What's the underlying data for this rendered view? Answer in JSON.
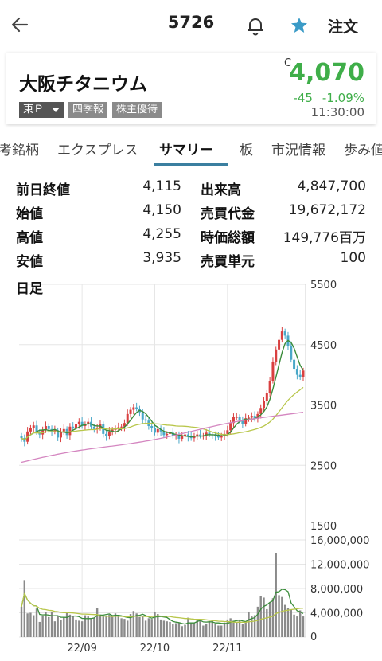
{
  "header": {
    "code": "5726",
    "order_label": "注文",
    "accent": "#3b9bc7"
  },
  "quote": {
    "name": "大阪チタニウム",
    "market": "東Ｐ",
    "tags": [
      "四季報",
      "株主優待"
    ],
    "close_mark": "C",
    "price": "4,070",
    "change": "-45",
    "change_pct": "-1.09%",
    "time": "11:30:00",
    "down_color": "#3fae49"
  },
  "tabs": [
    "考銘柄",
    "エクスプレス",
    "サマリー",
    "板",
    "市況情報",
    "歩み値"
  ],
  "active_tab": 2,
  "stats": [
    {
      "l1": "前日終値",
      "v1": "4,115",
      "l2": "出来高",
      "v2": "4,847,700"
    },
    {
      "l1": "始値",
      "v1": "4,150",
      "l2": "売買代金",
      "v2": "19,672,172"
    },
    {
      "l1": "高値",
      "v1": "4,255",
      "l2": "時価総額",
      "v2": "149,776百万"
    },
    {
      "l1": "安値",
      "v1": "3,935",
      "l2": "売買単元",
      "v2": "100"
    }
  ],
  "chart_data": {
    "type": "candlestick",
    "period_label": "日足",
    "price_ticks": [
      "5500",
      "4500",
      "3500",
      "2500",
      "1500"
    ],
    "volume_ticks": [
      "16,000,000",
      "12,000,000",
      "8,000,000",
      "4,000,000",
      "0"
    ],
    "date_labels": [
      "22/09",
      "22/10",
      "22/11"
    ],
    "price_ylim": [
      1500,
      5500
    ],
    "volume_ylim": [
      0,
      16000000
    ],
    "up_color": "#d94040",
    "down_color": "#4aa8c8",
    "ma_short_color": "#3a8c3a",
    "ma_mid_color": "#b8c64a",
    "ma_long_color": "#d486c0",
    "closes": [
      2950,
      2890,
      3060,
      3120,
      3160,
      3050,
      3010,
      3080,
      3150,
      3100,
      3060,
      3080,
      2960,
      3050,
      3100,
      3000,
      3140,
      3120,
      3180,
      3220,
      3150,
      3180,
      3220,
      3140,
      3100,
      3120,
      3180,
      3020,
      2980,
      3060,
      3090,
      3100,
      3130,
      3140,
      3200,
      3350,
      3420,
      3460,
      3440,
      3380,
      3260,
      3240,
      3150,
      3120,
      3040,
      3100,
      3060,
      3000,
      3020,
      3040,
      2990,
      3000,
      2940,
      2980,
      3010,
      2970,
      2950,
      2990,
      3010,
      2990,
      2990,
      3040,
      3010,
      3000,
      2980,
      2960,
      2990,
      3020,
      3080,
      3200,
      3300,
      3300,
      3250,
      3190,
      3280,
      3290,
      3320,
      3270,
      3350,
      3450,
      3560,
      3700,
      3900,
      4220,
      4420,
      4580,
      4720,
      4650,
      4480,
      4250,
      4100,
      4000,
      3960,
      4070
    ],
    "volumes": [
      5000000,
      9400000,
      3900000,
      4000000,
      3600000,
      4700000,
      2500000,
      3500000,
      4100000,
      3300000,
      4100000,
      2600000,
      3500000,
      2800000,
      3300000,
      4000000,
      3700000,
      3500000,
      2900000,
      2700000,
      2600000,
      3600000,
      3400000,
      3000000,
      3200000,
      4800000,
      3700000,
      3400000,
      3500000,
      3700000,
      3400000,
      3900000,
      3400000,
      3100000,
      3000000,
      2700000,
      3800000,
      4300000,
      3900000,
      3300000,
      3500000,
      2700000,
      3100000,
      3000000,
      4200000,
      3800000,
      2900000,
      2700000,
      2600000,
      2500000,
      2200000,
      2300000,
      2400000,
      1800000,
      2000000,
      3200000,
      2300000,
      2400000,
      2900000,
      3000000,
      1900000,
      2200000,
      2600000,
      2800000,
      2200000,
      1900000,
      1900000,
      2400000,
      2900000,
      3100000,
      2700000,
      2500000,
      2800000,
      2200000,
      2600000,
      4200000,
      3400000,
      3600000,
      5000000,
      6800000,
      6500000,
      4600000,
      5700000,
      6400000,
      13800000,
      6900000,
      6600000,
      5300000,
      4800000,
      4500000,
      3700000,
      3400000,
      4400000,
      3400000
    ]
  }
}
